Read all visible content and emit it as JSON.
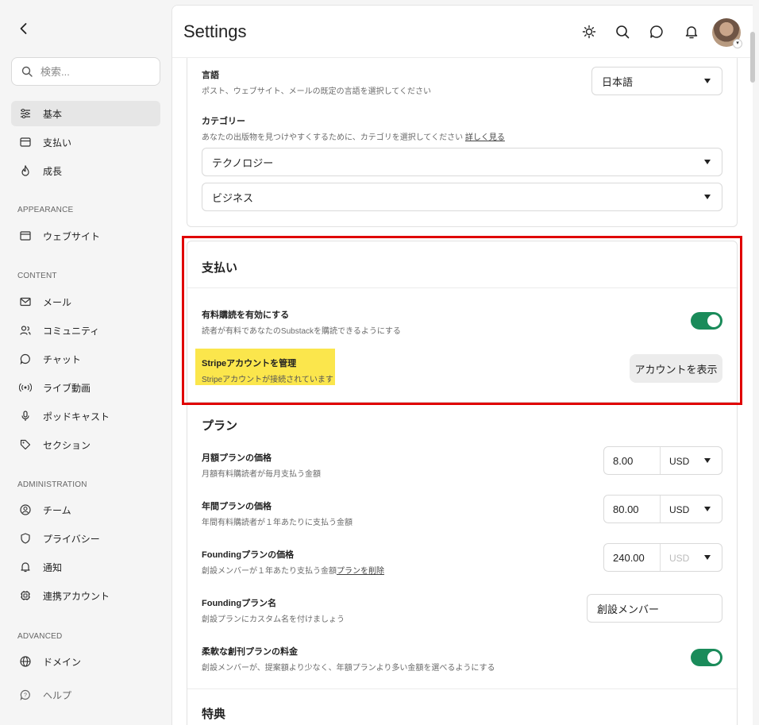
{
  "sidebar": {
    "search_placeholder": "検索...",
    "items_basic": [
      {
        "label": "基本",
        "icon": "sliders-icon"
      },
      {
        "label": "支払い",
        "icon": "card-icon"
      },
      {
        "label": "成長",
        "icon": "flame-icon"
      }
    ],
    "section_appearance": "APPEARANCE",
    "items_appearance": [
      {
        "label": "ウェブサイト",
        "icon": "browser-icon"
      }
    ],
    "section_content": "CONTENT",
    "items_content": [
      {
        "label": "メール",
        "icon": "mail-icon"
      },
      {
        "label": "コミュニティ",
        "icon": "users-icon"
      },
      {
        "label": "チャット",
        "icon": "chat-icon"
      },
      {
        "label": "ライブ動画",
        "icon": "broadcast-icon"
      },
      {
        "label": "ポッドキャスト",
        "icon": "mic-icon"
      },
      {
        "label": "セクション",
        "icon": "tag-icon"
      }
    ],
    "section_administration": "ADMINISTRATION",
    "items_administration": [
      {
        "label": "チーム",
        "icon": "team-icon"
      },
      {
        "label": "プライバシー",
        "icon": "shield-icon"
      },
      {
        "label": "通知",
        "icon": "bell-icon"
      },
      {
        "label": "連携アカウント",
        "icon": "link-icon"
      }
    ],
    "section_advanced": "ADVANCED",
    "items_advanced": [
      {
        "label": "ドメイン",
        "icon": "globe-icon"
      },
      {
        "label": "ヘルプ",
        "icon": "help-icon"
      }
    ]
  },
  "header": {
    "title": "Settings"
  },
  "language": {
    "label": "言語",
    "description": "ポスト、ウェブサイト、メールの既定の言語を選択してください",
    "value": "日本語"
  },
  "category": {
    "label": "カテゴリー",
    "description": "あなたの出版物を見つけやすくするために、カテゴリを選択してください",
    "link": "詳しく見る",
    "value1": "テクノロジー",
    "value2": "ビジネス"
  },
  "payments": {
    "title": "支払い",
    "paid_label": "有料購読を有効にする",
    "paid_desc": "読者が有料であなたのSubstackを購読できるようにする",
    "paid_enabled": true,
    "stripe_label": "Stripeアカウントを管理",
    "stripe_desc": "Stripeアカウントが接続されています",
    "stripe_button": "アカウントを表示"
  },
  "plans": {
    "title": "プラン",
    "monthly_label": "月額プランの価格",
    "monthly_desc": "月額有料購読者が毎月支払う金額",
    "monthly_value": "8.00",
    "monthly_currency": "USD",
    "yearly_label": "年間プランの価格",
    "yearly_desc": "年間有料購読者が１年あたりに支払う金額",
    "yearly_value": "80.00",
    "yearly_currency": "USD",
    "founding_label": "Foundingプランの価格",
    "founding_desc": "創設メンバーが１年あたり支払う金額",
    "founding_link": "プランを削除",
    "founding_value": "240.00",
    "founding_currency": "USD",
    "founding_name_label": "Foundingプラン名",
    "founding_name_desc": "創設プランにカスタム名を付けましょう",
    "founding_name_value": "創設メンバー",
    "flexible_label": "柔軟な創刊プランの料金",
    "flexible_desc": "創設メンバーが、提案額より少なく、年額プランより多い金額を選べるようにする",
    "flexible_enabled": true
  },
  "perks": {
    "title": "特典"
  },
  "colors": {
    "accent_green": "#1a8b5a",
    "highlight": "#fbe64c",
    "red_box": "#e00000"
  }
}
